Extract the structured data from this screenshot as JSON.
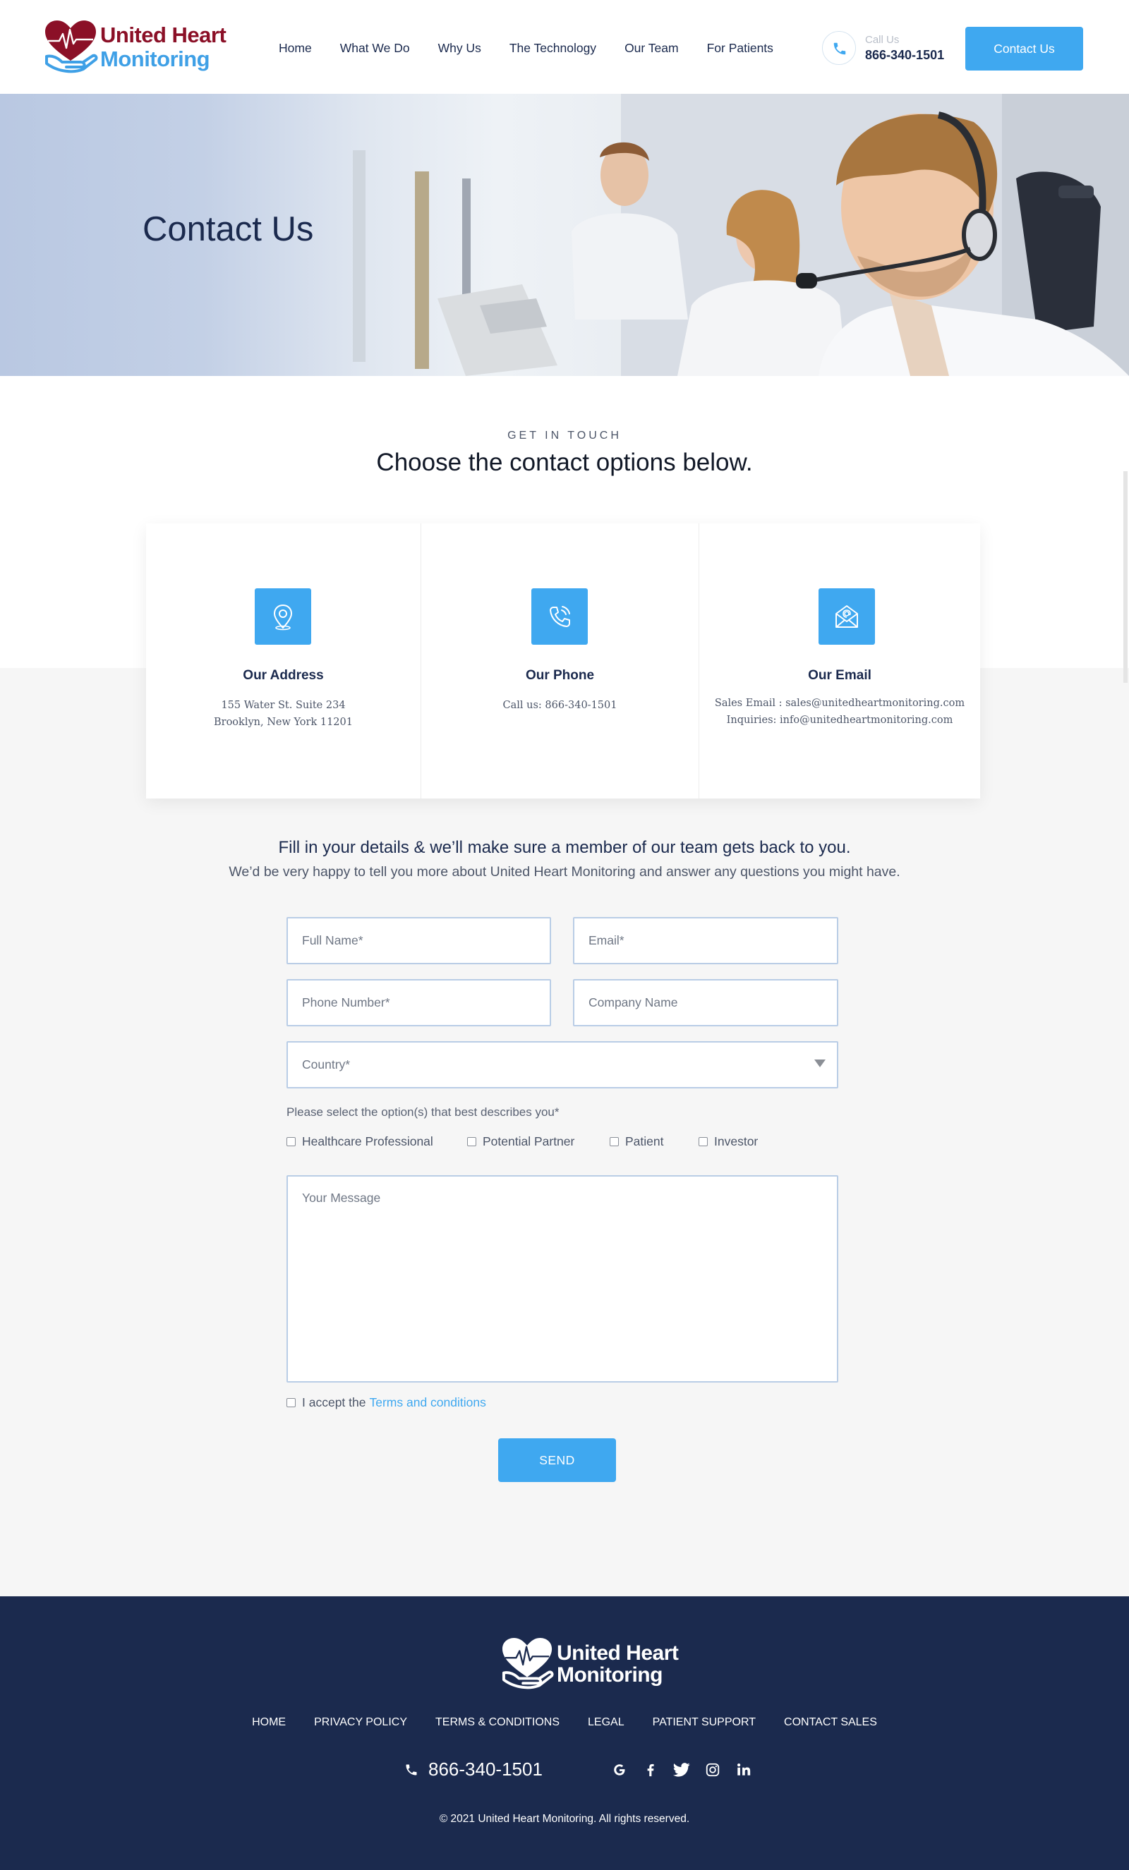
{
  "brand": {
    "line1": "United Heart",
    "line2": "Monitoring",
    "heart_color": "#8b1027",
    "hand_color": "#3fa0e6"
  },
  "nav": {
    "items": [
      "Home",
      "What We Do",
      "Why Us",
      "The Technology",
      "Our Team",
      "For Patients"
    ]
  },
  "call": {
    "label": "Call Us",
    "number": "866-340-1501",
    "icon": "phone-icon"
  },
  "header_button": "Contact Us",
  "hero": {
    "title": "Contact Us"
  },
  "touch": {
    "eyebrow": "GET IN TOUCH",
    "title": "Choose the contact options below."
  },
  "cards": [
    {
      "icon": "location-pin-icon",
      "title": "Our Address",
      "lines": [
        "155 Water St. Suite 234",
        "Brooklyn, New York 11201"
      ]
    },
    {
      "icon": "phone-wave-icon",
      "title": "Our Phone",
      "lines": [
        "Call us:  866-340-1501"
      ]
    },
    {
      "icon": "email-envelope-icon",
      "title": "Our Email",
      "lines": [
        "Sales Email : sales@unitedheartmonitoring.com",
        "Inquiries: info@unitedheartmonitoring.com"
      ]
    }
  ],
  "form": {
    "heading": "Fill in your details & we’ll make sure a member of our team gets back to you.",
    "subheading": "We’d be very happy to tell you more about United Heart Monitoring and answer any questions you might have.",
    "full_name": "Full Name*",
    "email": "Email*",
    "phone": "Phone Number*",
    "company": "Company Name",
    "country": "Country*",
    "select_desc": "Please select the option(s) that best describes you*",
    "options": [
      "Healthcare Professional",
      "Potential Partner",
      "Patient",
      "Investor"
    ],
    "message": "Your Message",
    "accept_prefix": "I accept the",
    "terms": "Terms and conditions",
    "send": "SEND"
  },
  "footer": {
    "links": [
      "HOME",
      "PRIVACY POLICY",
      "TERMS & CONDITIONS",
      "LEGAL",
      "PATIENT SUPPORT",
      "CONTACT SALES"
    ],
    "phone": "866-340-1501",
    "social": [
      "google-icon",
      "facebook-icon",
      "twitter-icon",
      "instagram-icon",
      "linkedin-icon"
    ],
    "copyright": "© 2021 United Heart Monitoring. All rights reserved.",
    "background": "#1b2a4e"
  },
  "colors": {
    "accent": "#3fa8f0",
    "navy": "#1b2a4e"
  }
}
